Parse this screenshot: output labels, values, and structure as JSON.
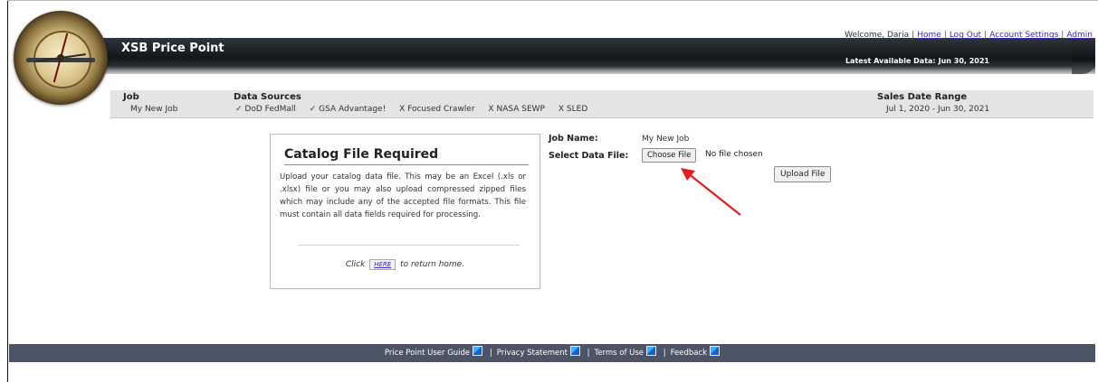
{
  "header": {
    "app_title": "XSB Price Point",
    "latest_label": "Latest Available Data:",
    "latest_date": "Jun 30, 2021",
    "welcome_text": "Welcome, Daria",
    "links": {
      "home": "Home",
      "logout": "Log Out",
      "account": "Account Settings",
      "admin": "Admin"
    }
  },
  "info_bar": {
    "job_label": "Job",
    "job_value": "My New Job",
    "sources_label": "Data Sources",
    "sources": [
      {
        "mark": "✓",
        "name": "DoD FedMall"
      },
      {
        "mark": "✓",
        "name": "GSA Advantage!"
      },
      {
        "mark": "X",
        "name": "Focused Crawler"
      },
      {
        "mark": "X",
        "name": "NASA SEWP"
      },
      {
        "mark": "X",
        "name": "SLED"
      }
    ],
    "sales_label": "Sales Date Range",
    "sales_value": "Jul 1, 2020 - Jun 30, 2021"
  },
  "message": {
    "title": "Catalog File Required",
    "body": "Upload your catalog data file. This may be an Excel (.xls or .xlsx) file or you may also upload compressed zipped files which may include any of the accepted file formats. This file must contain all data fields required for processing.",
    "click_prefix": "Click",
    "here_label": "HERE",
    "click_suffix": "to return home."
  },
  "form": {
    "job_name_label": "Job Name:",
    "job_name_value": "My New Job",
    "select_label": "Select Data File:",
    "choose_button": "Choose File",
    "no_file_text": "No file chosen",
    "upload_button": "Upload File"
  },
  "footer": {
    "guide": "Price Point User Guide",
    "privacy": "Privacy Statement",
    "terms": "Terms of Use",
    "feedback": "Feedback",
    "separator": "|"
  },
  "colors": {
    "header_dark": "#141619",
    "footer": "#4b5565",
    "link": "#3b2bb0",
    "annotation_arrow": "#e02020"
  }
}
